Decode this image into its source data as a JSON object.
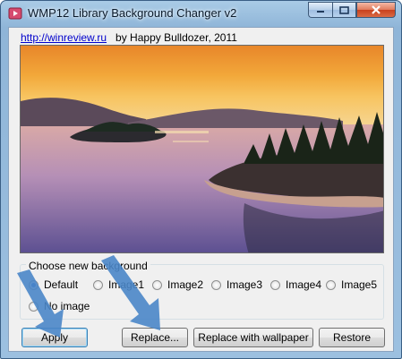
{
  "window": {
    "title": "WMP12 Library Background Changer v2",
    "icon": "app-icon",
    "controls": [
      "minimize-icon",
      "maximize-icon",
      "close-icon"
    ]
  },
  "credits": {
    "link": "http://winreview.ru",
    "author": "by Happy Bulldozer, 2011"
  },
  "preview": {
    "description_icon": "landscape-preview-image"
  },
  "background_group": {
    "legend": "Choose new background",
    "options": [
      {
        "label": "Default",
        "checked": true
      },
      {
        "label": "Image1",
        "checked": false
      },
      {
        "label": "Image2",
        "checked": false
      },
      {
        "label": "Image3",
        "checked": false
      },
      {
        "label": "Image4",
        "checked": false
      },
      {
        "label": "Image5",
        "checked": false
      },
      {
        "label": "No image",
        "checked": false
      }
    ]
  },
  "buttons": {
    "apply": "Apply",
    "replace": "Replace...",
    "replace_wallpaper": "Replace with wallpaper",
    "restore": "Restore"
  },
  "colors": {
    "accent": "#3c7fb1",
    "arrow_overlay": "#4a86c8",
    "link": "#0000cc"
  }
}
